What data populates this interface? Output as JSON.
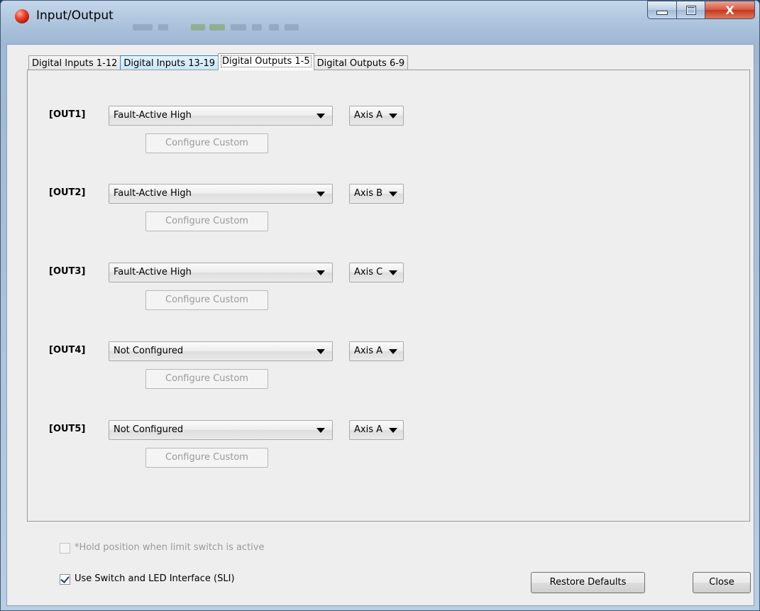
{
  "window": {
    "title": "Input/Output"
  },
  "tabs": [
    {
      "label": "Digital Inputs 1-12"
    },
    {
      "label": "Digital Inputs 13-19"
    },
    {
      "label": "Digital Outputs 1-5"
    },
    {
      "label": "Digital Outputs 6-9"
    }
  ],
  "active_tab": "Digital Outputs 1-5",
  "outputs": [
    {
      "label": "[OUT1]",
      "function": "Fault-Active High",
      "axis": "Axis A",
      "configure": "Configure Custom"
    },
    {
      "label": "[OUT2]",
      "function": "Fault-Active High",
      "axis": "Axis B",
      "configure": "Configure Custom"
    },
    {
      "label": "[OUT3]",
      "function": "Fault-Active High",
      "axis": "Axis C",
      "configure": "Configure Custom"
    },
    {
      "label": "[OUT4]",
      "function": "Not Configured",
      "axis": "Axis A",
      "configure": "Configure Custom"
    },
    {
      "label": "[OUT5]",
      "function": "Not Configured",
      "axis": "Axis A",
      "configure": "Configure Custom"
    }
  ],
  "options": {
    "hold_position": {
      "label": "*Hold position when limit switch is active",
      "checked": false,
      "enabled": false
    },
    "use_sli": {
      "label": "Use Switch and LED Interface (SLI)",
      "checked": true,
      "enabled": true
    }
  },
  "buttons": {
    "restore": "Restore Defaults",
    "close": "Close"
  },
  "caption": {
    "close_glyph": "X"
  },
  "colors": {
    "title_bar": "#b9cde3",
    "client_bg": "#eeeeee",
    "tab_hover": "#c6e6f7",
    "close_button": "#c4371d"
  }
}
